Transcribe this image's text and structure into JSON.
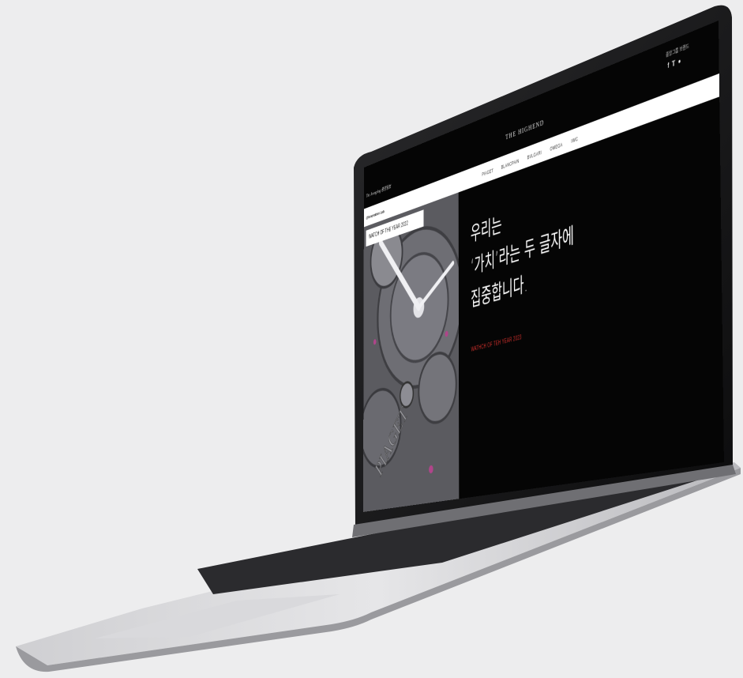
{
  "site": {
    "brand": "THE HIGHEND",
    "partner_logo": "The JoongAng 중앙일보",
    "language_link": "중앙그룹 브랜드",
    "social_icons": [
      "facebook-icon",
      "twitter-icon",
      "kakao-icon"
    ]
  },
  "nav": {
    "lab_label": "@Innovation Lab",
    "items": [
      "PIAGET",
      "BLANCPAIN",
      "BVLGARI",
      "OMEGA",
      "IWC"
    ]
  },
  "hero": {
    "image_caption": "WATCH OF THE YEAR 2022",
    "watch_mark": "PIAGET",
    "headline_lines": [
      "우리는",
      "‘가치’라는 두 글자에",
      "집중합니다."
    ],
    "subheadline": "WATHCH OF TEH YEAR 2023"
  },
  "colors": {
    "accent_red": "#d2302c",
    "screen_bg": "#050505",
    "page_bg": "#ededee"
  }
}
